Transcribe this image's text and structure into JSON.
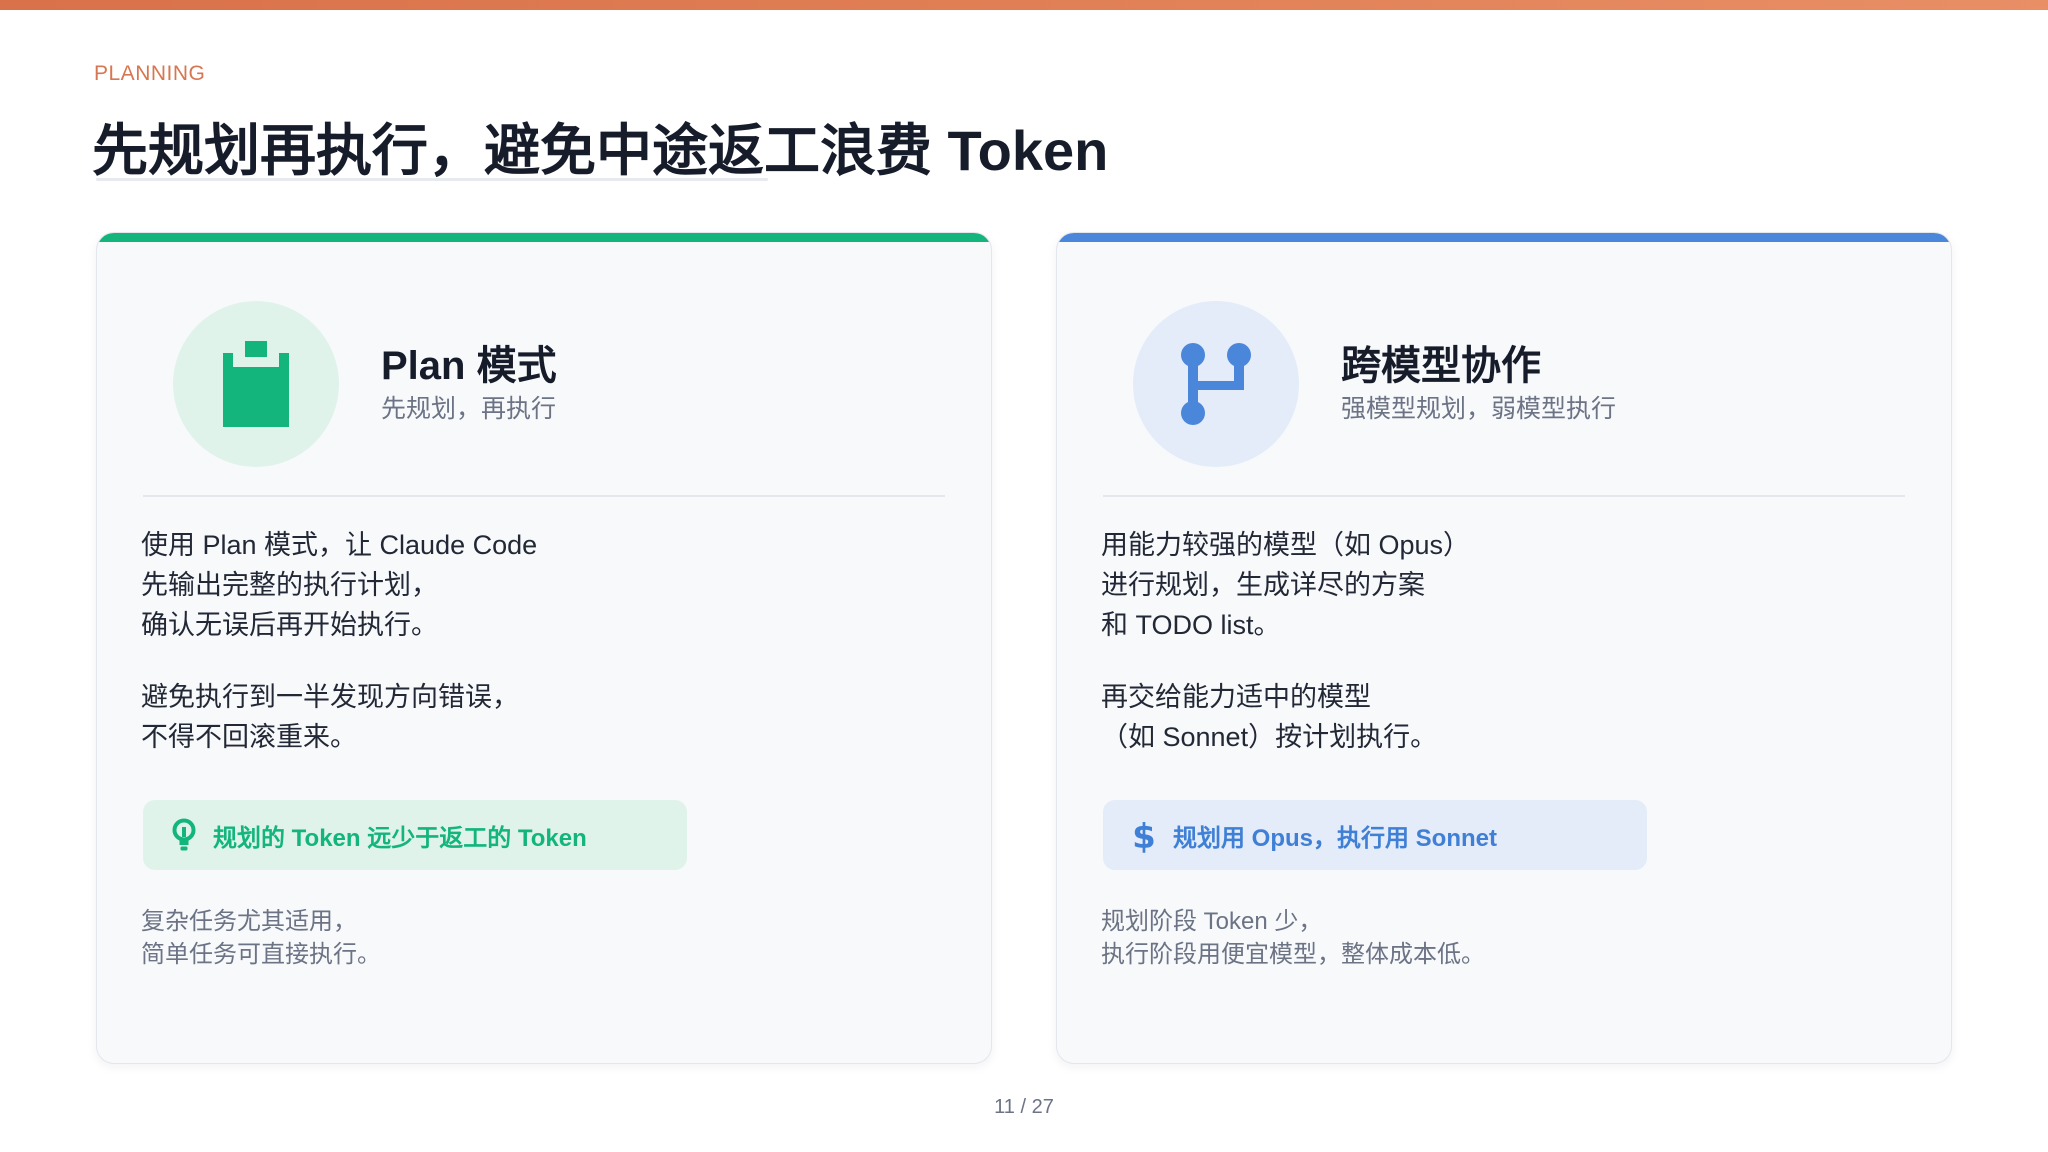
{
  "header": {
    "eyebrow": "PLANNING",
    "title": "先规划再执行，避免中途返工浪费 Token"
  },
  "cards": [
    {
      "accent_color": "#13b57c",
      "icon": "clipboard-icon",
      "title": "Plan 模式",
      "subtitle": "先规划，再执行",
      "para1": [
        "使用 Plan 模式，让 Claude Code",
        "先输出完整的执行计划，",
        "确认无误后再开始执行。"
      ],
      "para2": [
        "避免执行到一半发现方向错误，",
        "不得不回滚重来。"
      ],
      "pill_icon": "lightbulb-icon",
      "pill_text": "规划的 Token 远少于返工的 Token",
      "note": [
        "复杂任务尤其适用，",
        "简单任务可直接执行。"
      ]
    },
    {
      "accent_color": "#4a86d9",
      "icon": "branch-icon",
      "title": "跨模型协作",
      "subtitle": "强模型规划，弱模型执行",
      "para1": [
        "用能力较强的模型（如 Opus）",
        "进行规划，生成详尽的方案",
        "和 TODO list。"
      ],
      "para2": [
        "再交给能力适中的模型",
        "（如 Sonnet）按计划执行。"
      ],
      "pill_icon": "dollar-icon",
      "pill_text": "规划用 Opus，执行用 Sonnet",
      "note": [
        "规划阶段 Token 少，",
        "执行阶段用便宜模型，整体成本低。"
      ]
    }
  ],
  "footer": {
    "page_number": "11 / 27"
  }
}
